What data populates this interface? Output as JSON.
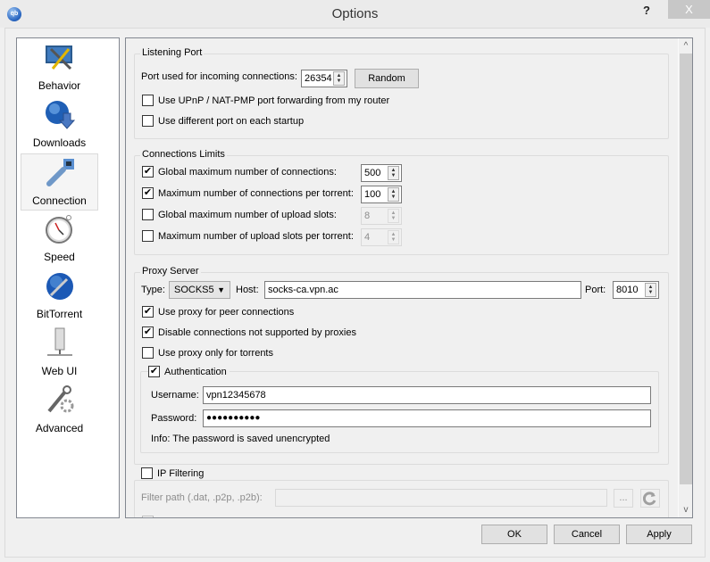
{
  "window": {
    "title": "Options",
    "app_icon": "qbittorrent-logo",
    "help_label": "?",
    "close_label": "X"
  },
  "sidebar": {
    "items": [
      {
        "label": "Behavior",
        "icon": "behavior-icon",
        "active": false
      },
      {
        "label": "Downloads",
        "icon": "downloads-icon",
        "active": false
      },
      {
        "label": "Connection",
        "icon": "connection-icon",
        "active": true
      },
      {
        "label": "Speed",
        "icon": "speed-icon",
        "active": false
      },
      {
        "label": "BitTorrent",
        "icon": "bittorrent-icon",
        "active": false
      },
      {
        "label": "Web UI",
        "icon": "webui-icon",
        "active": false
      },
      {
        "label": "Advanced",
        "icon": "advanced-icon",
        "active": false
      }
    ]
  },
  "listening_port": {
    "title": "Listening Port",
    "port_label": "Port used for incoming connections:",
    "port_value": "26354",
    "random_label": "Random",
    "upnp_label": "Use UPnP / NAT-PMP port forwarding from my router",
    "upnp_checked": false,
    "diff_port_label": "Use different port on each startup",
    "diff_port_checked": false
  },
  "connection_limits": {
    "title": "Connections Limits",
    "global_max_label": "Global maximum number of connections:",
    "global_max_value": "500",
    "global_max_checked": true,
    "per_torrent_label": "Maximum number of connections per torrent:",
    "per_torrent_value": "100",
    "per_torrent_checked": true,
    "global_upload_label": "Global maximum number of upload slots:",
    "global_upload_value": "8",
    "global_upload_checked": false,
    "upload_per_torrent_label": "Maximum number of upload slots per torrent:",
    "upload_per_torrent_value": "4",
    "upload_per_torrent_checked": false
  },
  "proxy": {
    "title": "Proxy Server",
    "type_label": "Type:",
    "type_value": "SOCKS5",
    "host_label": "Host:",
    "host_value": "socks-ca.vpn.ac",
    "port_label": "Port:",
    "port_value": "8010",
    "peer_label": "Use proxy for peer connections",
    "peer_checked": true,
    "disable_label": "Disable connections not supported by proxies",
    "disable_checked": true,
    "torrents_only_label": "Use proxy only for torrents",
    "torrents_only_checked": false,
    "auth": {
      "title": "Authentication",
      "checked": true,
      "username_label": "Username:",
      "username_value": "vpn12345678",
      "password_label": "Password:",
      "password_value": "●●●●●●●●●●",
      "info": "Info: The password is saved unencrypted"
    }
  },
  "ip_filtering": {
    "title": "IP Filtering",
    "checked": false,
    "filter_path_label": "Filter path (.dat, .p2p, .p2b):",
    "filter_path_value": "",
    "browse_label": "...",
    "reload_icon": "reload-icon"
  },
  "footer": {
    "ok_label": "OK",
    "cancel_label": "Cancel",
    "apply_label": "Apply"
  },
  "glyphs": {
    "check": "✔",
    "up": "▲",
    "down": "▼",
    "caret": "▼",
    "scroll_up": "^",
    "scroll_down": "v"
  }
}
